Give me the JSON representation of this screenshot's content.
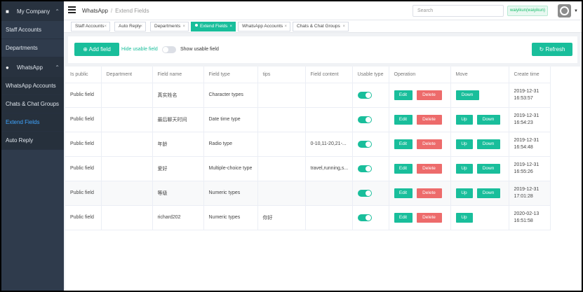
{
  "sidebar": {
    "group_company": {
      "icon": "company-icon",
      "label": "My Company"
    },
    "company_items": [
      {
        "label": "Staff Accounts"
      },
      {
        "label": "Departments"
      }
    ],
    "group_whatsapp": {
      "icon": "whatsapp-icon",
      "label": "WhatsApp"
    },
    "whatsapp_items": [
      {
        "label": "WhatsApp Accounts"
      },
      {
        "label": "Chats & Chat Groups"
      },
      {
        "label": "Extend Fields"
      },
      {
        "label": "Auto Reply"
      }
    ],
    "active_item": "Extend Fields"
  },
  "header": {
    "breadcrumb": [
      "WhatsApp",
      "Extend Fields"
    ],
    "search_placeholder": "Search",
    "user_label": "waiyikun(waiyikun)"
  },
  "tabs": [
    {
      "label": "Staff Accounts"
    },
    {
      "label": "Auto Reply"
    },
    {
      "label": "Departments"
    },
    {
      "label": "Extend Fields",
      "active": true
    },
    {
      "label": "WhatsApp Accounts"
    },
    {
      "label": "Chats & Chat Groups"
    }
  ],
  "toolbar": {
    "add_label": "Add field",
    "hide_label": "Hide usable field",
    "show_label": "Show usable field",
    "refresh_label": "Refresh"
  },
  "table": {
    "columns": [
      "Is public",
      "Department",
      "Field name",
      "Field type",
      "tips",
      "Field content",
      "Usable type",
      "Operation",
      "Move",
      "Create time"
    ],
    "edit_label": "Edit",
    "delete_label": "Delete",
    "up_label": "Up",
    "down_label": "Down",
    "rows": [
      {
        "is_public": "Public field",
        "department": "",
        "field_name": "真实姓名",
        "field_type": "Character types",
        "tips": "",
        "content": "",
        "usable": true,
        "date": "2019-12-31",
        "time": "16:53:57"
      },
      {
        "is_public": "Public field",
        "department": "",
        "field_name": "最后聊天时间",
        "field_type": "Date time type",
        "tips": "",
        "content": "",
        "usable": true,
        "date": "2019-12-31",
        "time": "16:54:23"
      },
      {
        "is_public": "Public field",
        "department": "",
        "field_name": "年龄",
        "field_type": "Radio type",
        "tips": "",
        "content": "0-10,11-20,21-...",
        "usable": true,
        "date": "2019-12-31",
        "time": "16:54:48"
      },
      {
        "is_public": "Public field",
        "department": "",
        "field_name": "爱好",
        "field_type": "Multiple-choice type",
        "tips": "",
        "content": "travel,running,s...",
        "usable": true,
        "date": "2019-12-31",
        "time": "16:55:26"
      },
      {
        "is_public": "Public field",
        "department": "",
        "field_name": "等级",
        "field_type": "Numeric types",
        "tips": "",
        "content": "",
        "usable": true,
        "date": "2019-12-31",
        "time": "17:01:28"
      },
      {
        "is_public": "Public field",
        "department": "",
        "field_name": "richard202",
        "field_type": "Numeric types",
        "tips": "你好",
        "content": "",
        "usable": true,
        "date": "2020-02-13",
        "time": "16:51:58"
      }
    ]
  },
  "colors": {
    "accent": "#19be9b",
    "danger": "#ed6b6b",
    "sidebar": "#2f3b4c",
    "active_link": "#3fa5ff"
  }
}
